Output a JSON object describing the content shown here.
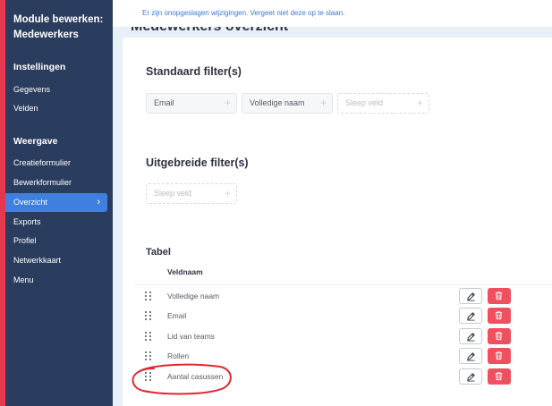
{
  "notice": "Er zijn onopgeslagen wijzigingen. Vergeet niet deze op te slaan.",
  "sidebar": {
    "title_line1": "Module bewerken:",
    "title_line2": "Medewerkers",
    "sections": {
      "settings": "Instellingen",
      "view": "Weergave"
    },
    "settings_items": [
      "Gegevens",
      "Velden"
    ],
    "view_items": [
      "Creatieformulier",
      "Bewerkformulier",
      "Overzicht",
      "Exports",
      "Profiel",
      "Netwerkkaart",
      "Menu"
    ],
    "active_item": "Overzicht"
  },
  "page": {
    "cut_title": "Medewerkers overzicht"
  },
  "standard_filters": {
    "heading": "Standaard filter(s)",
    "fields": [
      "Email",
      "Volledige naam"
    ],
    "drop_placeholder": "Sleep veld"
  },
  "advanced_filters": {
    "heading": "Uitgebreide filter(s)",
    "drop_placeholder": "Sleep veld"
  },
  "table": {
    "heading": "Tabel",
    "column_header": "Veldnaam",
    "rows": [
      "Volledige naam",
      "Email",
      "Lid van teams",
      "Rollen",
      "Aantal casussen"
    ]
  },
  "colors": {
    "sidebar_bg": "#2b3d5e",
    "accent_red": "#e8364f",
    "active_blue": "#3f7fe0",
    "notice_blue": "#3a78d8",
    "delete_red": "#f0505d"
  },
  "icons": {
    "drag": "drag-handle-icon",
    "edit": "edit-icon",
    "delete": "trash-icon",
    "chevron": "chevron-right-icon"
  }
}
